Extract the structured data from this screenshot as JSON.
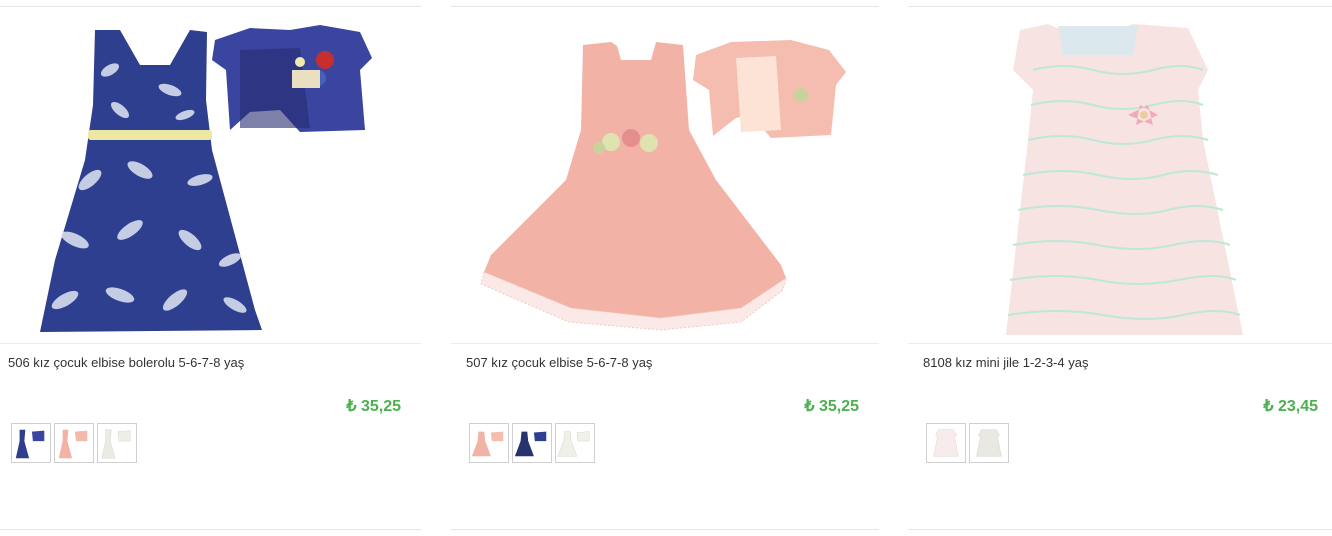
{
  "products": [
    {
      "title": "506 kız çocuk elbise bolerolu 5-6-7-8 yaş",
      "price": "₺ 35,25",
      "thumbnails": [
        "navy dress with bolero",
        "pink dress with bolero",
        "white dress with bolero"
      ]
    },
    {
      "title": "507 kız çocuk elbise 5-6-7-8 yaş",
      "price": "₺ 35,25",
      "thumbnails": [
        "pink dress",
        "navy dress",
        "white dress"
      ]
    },
    {
      "title": "8108 kız mini jile 1-2-3-4 yaş",
      "price": "₺ 23,45",
      "thumbnails": [
        "light pink mini dress",
        "white mini dress"
      ]
    }
  ],
  "colors": {
    "price": "#4caf50",
    "navy": "#2e3f8f",
    "pink": "#f3b2a6",
    "pale_pink": "#f7e3e2"
  }
}
